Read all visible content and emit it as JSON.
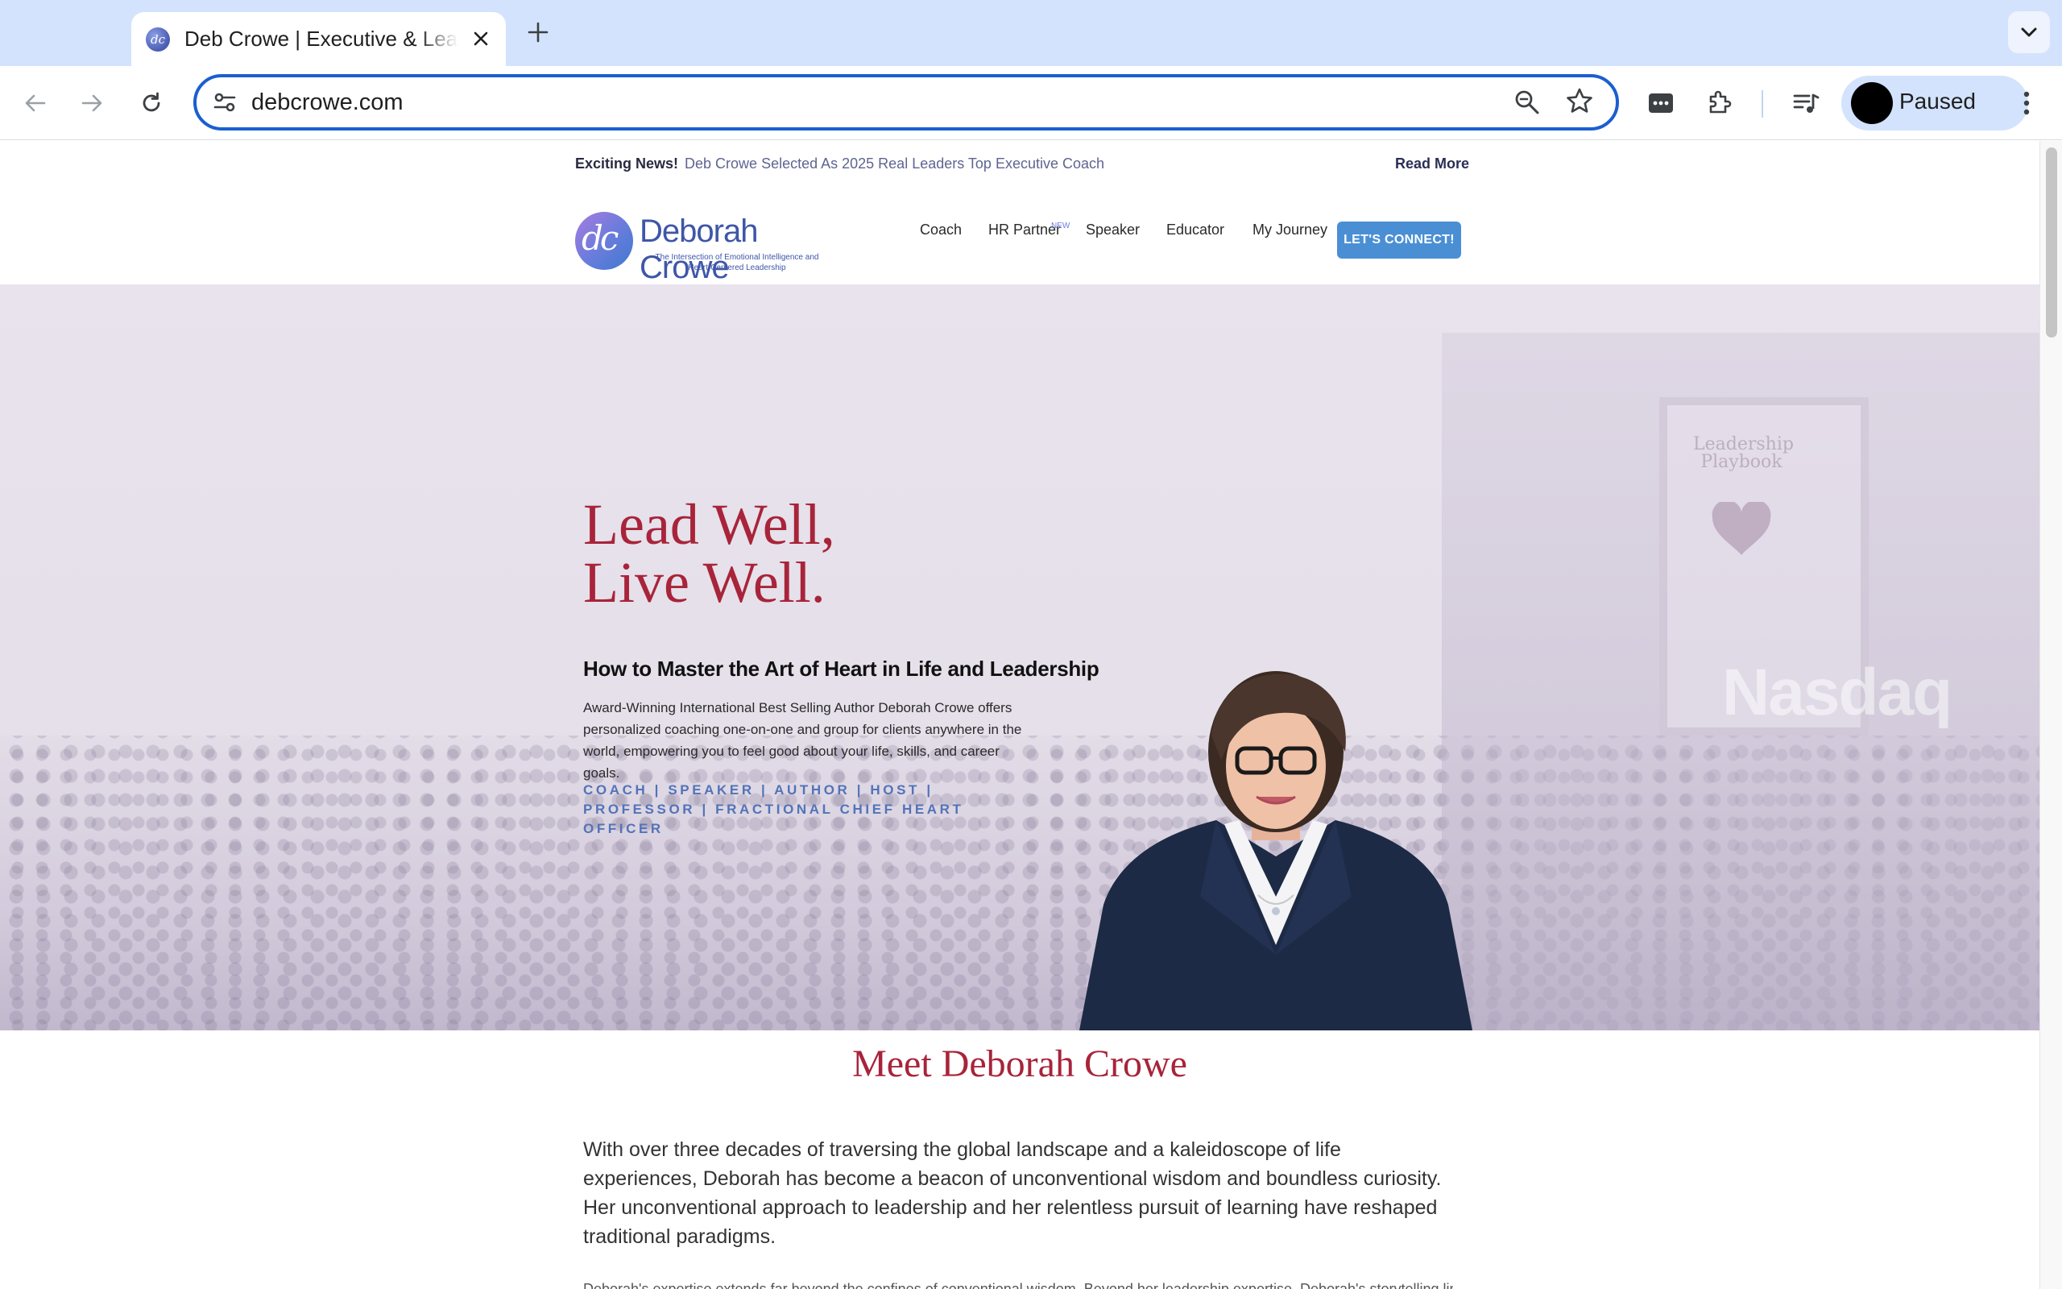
{
  "browser": {
    "tab_title": "Deb Crowe | Executive & Leadership Coach",
    "url": "debcrowe.com",
    "profile_label": "Paused"
  },
  "announcement": {
    "label": "Exciting News!",
    "message": "Deb Crowe Selected As 2025 Real Leaders Top Executive Coach",
    "link": "Read More"
  },
  "logo": {
    "monogram": "dc",
    "name": "Deborah Crowe",
    "tagline": "The Intersection of Emotional Intelligence and Heart-Centered Leadership"
  },
  "nav": {
    "items": [
      "Coach",
      "HR Partner",
      "Speaker",
      "Educator",
      "My Journey"
    ],
    "new_badge": "NEW",
    "cta": "LET'S CONNECT!"
  },
  "hero": {
    "headline_line1": "Lead Well,",
    "headline_line2": "Live Well.",
    "subheading": "How to Master the Art of Heart in Life and Leadership",
    "description": "Award-Winning International Best Selling Author Deborah Crowe offers personalized coaching one-on-one and group for clients anywhere in the world, empowering you to feel good about your life, skills, and career goals.",
    "roles": "COACH | SPEAKER | AUTHOR | HOST | PROFESSOR | FRACTIONAL CHIEF HEART OFFICER",
    "bg_sign": "Nasdaq",
    "bg_book": "Leadership Playbook"
  },
  "meet": {
    "title": "Meet Deborah Crowe",
    "paragraph": "With over three decades of traversing the global landscape and a kaleidoscope of life experiences, Deborah has become a beacon of unconventional wisdom and boundless curiosity. Her unconventional approach to leadership and her relentless pursuit of learning have reshaped traditional paradigms.",
    "partial_line": "Deborah's expertise extends far beyond the confines of conventional wisdom. Beyond her leadership expertise, Deborah's storytelling limits"
  },
  "colors": {
    "accent_red": "#a8243a",
    "brand_blue": "#3e56a8",
    "cta_blue": "#4a8fd4",
    "chrome_blue": "#d3e3fd"
  }
}
